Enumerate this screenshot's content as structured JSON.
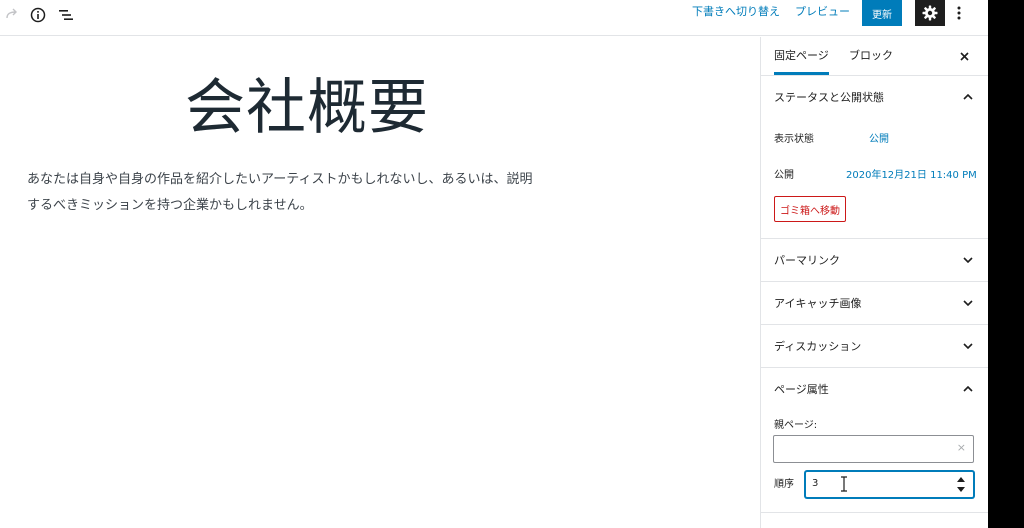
{
  "toolbar": {
    "save_draft_label": "下書きへ切り替え",
    "preview_label": "プレビュー",
    "update_label": "更新",
    "accent_color": "#007cba"
  },
  "editor": {
    "title": "会社概要",
    "paragraph_line1": "あなたは自身や自身の作品を紹介したいアーティストかもしれないし、あるいは、説明",
    "paragraph_line2": "するべきミッションを持つ企業かもしれません。"
  },
  "sidebar": {
    "tabs": [
      {
        "label": "固定ページ",
        "active": true
      },
      {
        "label": "ブロック",
        "active": false
      }
    ],
    "status_panel": {
      "title": "ステータスと公開状態",
      "visibility_label": "表示状態",
      "visibility_value": "公開",
      "publish_label": "公開",
      "publish_value": "2020年12月21日 11:40 PM",
      "trash_label": "ゴミ箱へ移動"
    },
    "permalink_title": "パーマリンク",
    "featured_image_title": "アイキャッチ画像",
    "discussion_title": "ディスカッション",
    "page_attributes": {
      "title": "ページ属性",
      "parent_label": "親ページ:",
      "parent_clear": "×",
      "order_label": "順序",
      "order_value": "3"
    }
  }
}
